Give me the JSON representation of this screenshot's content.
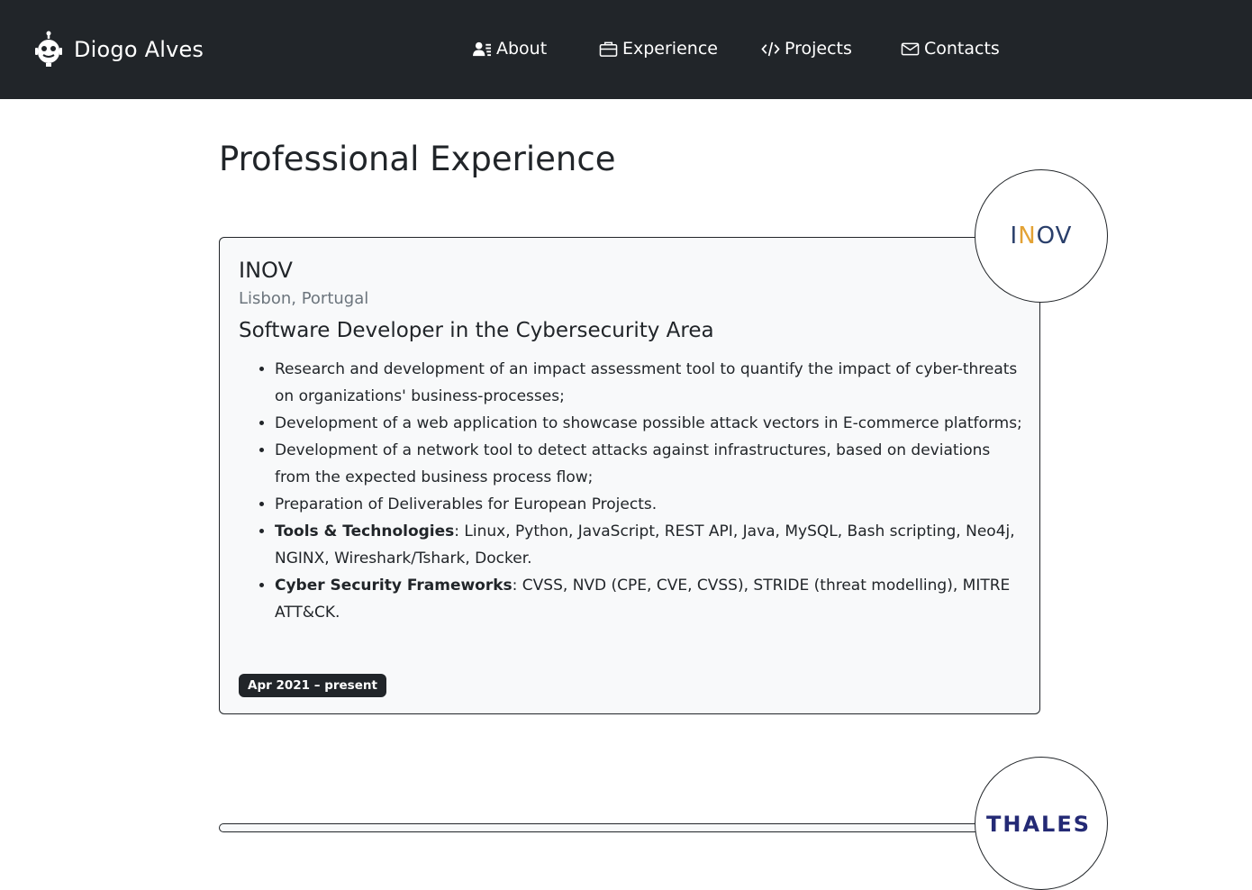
{
  "brand": {
    "name": "Diogo Alves",
    "icon": "robot-icon"
  },
  "nav": {
    "items": [
      {
        "label": "About",
        "icon": "person-lines-icon"
      },
      {
        "label": "Experience",
        "icon": "briefcase-icon"
      },
      {
        "label": "Projects",
        "icon": "code-slash-icon"
      },
      {
        "label": "Contacts",
        "icon": "envelope-icon"
      }
    ]
  },
  "page": {
    "title": "Professional Experience"
  },
  "experience": [
    {
      "company": "INOV",
      "location": "Lisbon, Portugal",
      "role": "Software Developer in the Cybersecurity Area",
      "duties": [
        "Research and development of an impact assessment tool to quantify the impact of cyber-threats on organizations' business-processes;",
        "Development of a web application to showcase possible attack vectors in E-commerce platforms;",
        "Development of a network tool to detect attacks against infrastructures, based on deviations from the expected business process flow;",
        "Preparation of Deliverables for European Projects."
      ],
      "tools_label": "Tools & Technologies",
      "tools": ": Linux, Python, JavaScript, REST API, Java, MySQL, Bash scripting, Neo4j, NGINX, Wireshark/Tshark, Docker.",
      "frameworks_label": "Cyber Security Frameworks",
      "frameworks": ": CVSS, NVD (CPE, CVE, CVSS), STRIDE (threat modelling), MITRE ATT&CK.",
      "period": "Apr 2021 – present",
      "logo": {
        "text_a": "I",
        "text_b": "N",
        "text_c": "OV"
      }
    },
    {
      "logo": {
        "text": "THALES"
      }
    }
  ],
  "colors": {
    "navbar": "#212529",
    "card_bg": "#f8f9fa",
    "muted": "#6c757d",
    "inov_blue": "#2a3f6b",
    "inov_orange": "#e3a234",
    "thales_blue": "#242a75"
  }
}
